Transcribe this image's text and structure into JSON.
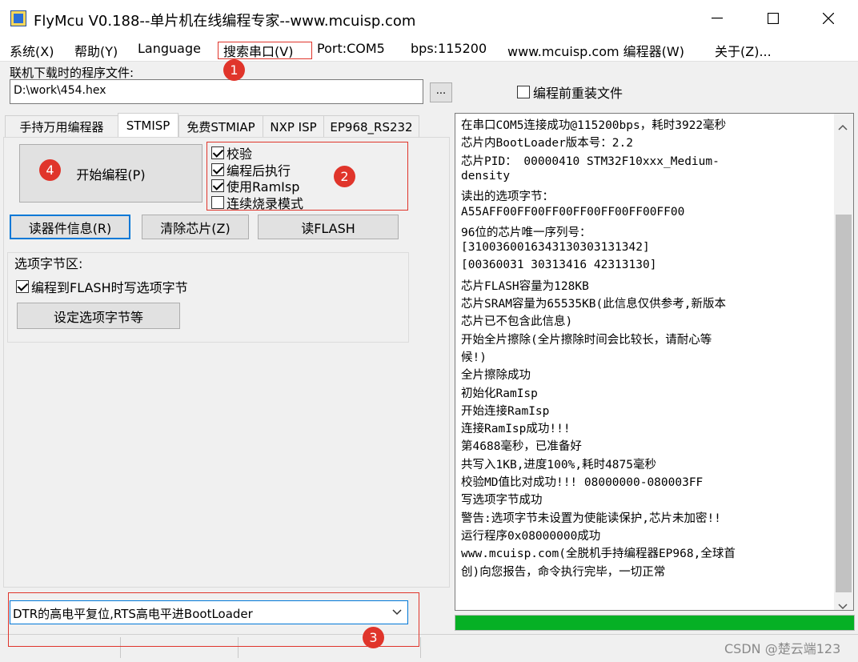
{
  "window": {
    "title": "FlyMcu V0.188--单片机在线编程专家--www.mcuisp.com"
  },
  "menu": [
    {
      "label": "系统(X)"
    },
    {
      "label": "帮助(Y)"
    },
    {
      "label": "Language"
    },
    {
      "label": "搜索串口(V)"
    },
    {
      "label": "Port:COM5"
    },
    {
      "label": "bps:115200"
    },
    {
      "label": "www.mcuisp.com 编程器(W)"
    },
    {
      "label": "关于(Z)..."
    }
  ],
  "file": {
    "label": "联机下载时的程序文件:",
    "path": "D:\\work\\454.hex",
    "browse": "...",
    "reload_label": "编程前重装文件"
  },
  "tabs": [
    {
      "label": "手持万用编程器"
    },
    {
      "label": "STMISP"
    },
    {
      "label": "免费STMIAP"
    },
    {
      "label": "NXP ISP"
    },
    {
      "label": "EP968_RS232"
    }
  ],
  "stmisp": {
    "start_button": "开始编程(P)",
    "checks": [
      {
        "label": "校验",
        "checked": true
      },
      {
        "label": "编程后执行",
        "checked": true
      },
      {
        "label": "使用RamIsp",
        "checked": true
      },
      {
        "label": "连续烧录模式",
        "checked": false
      }
    ],
    "read_info": "读器件信息(R)",
    "erase": "清除芯片(Z)",
    "read_flash": "读FLASH",
    "option_group_title": "选项字节区:",
    "option_check": "编程到FLASH时写选项字节",
    "option_button": "设定选项字节等"
  },
  "mode_select": {
    "value": "DTR的高电平复位,RTS高电平进BootLoader"
  },
  "log_lines": [
    "在串口COM5连接成功@115200bps，耗时3922毫秒",
    "芯片内BootLoader版本号：2.2",
    "芯片PID： 00000410  STM32F10xxx_Medium-",
    "density",
    "读出的选项字节：",
    "A55AFF00FF00FF00FF00FF00FF00FF00",
    "96位的芯片唯一序列号：",
    "[3100360016343130303131342]",
    "[00360031 30313416 42313130]",
    "芯片FLASH容量为128KB",
    "芯片SRAM容量为65535KB(此信息仅供参考,新版本",
    "芯片已不包含此信息)",
    "开始全片擦除(全片擦除时间会比较长，请耐心等",
    "候!)",
    "全片擦除成功",
    "初始化RamIsp",
    "开始连接RamIsp",
    "连接RamIsp成功!!!",
    "第4688毫秒，已准备好",
    "共写入1KB,进度100%,耗时4875毫秒",
    "校验MD值比对成功!!! 08000000-080003FF",
    "写选项字节成功",
    "警告:选项字节未设置为使能读保护,芯片未加密!!",
    "运行程序0x08000000成功",
    "www.mcuisp.com(全脱机手持编程器EP968,全球首",
    "创)向您报告，命令执行完毕，一切正常"
  ],
  "progress": {
    "percent": 100,
    "color": "#06b025"
  },
  "annotations": [
    "1",
    "2",
    "3",
    "4"
  ],
  "annotation_color": "#e0352b",
  "watermark": "CSDN @楚云端123"
}
